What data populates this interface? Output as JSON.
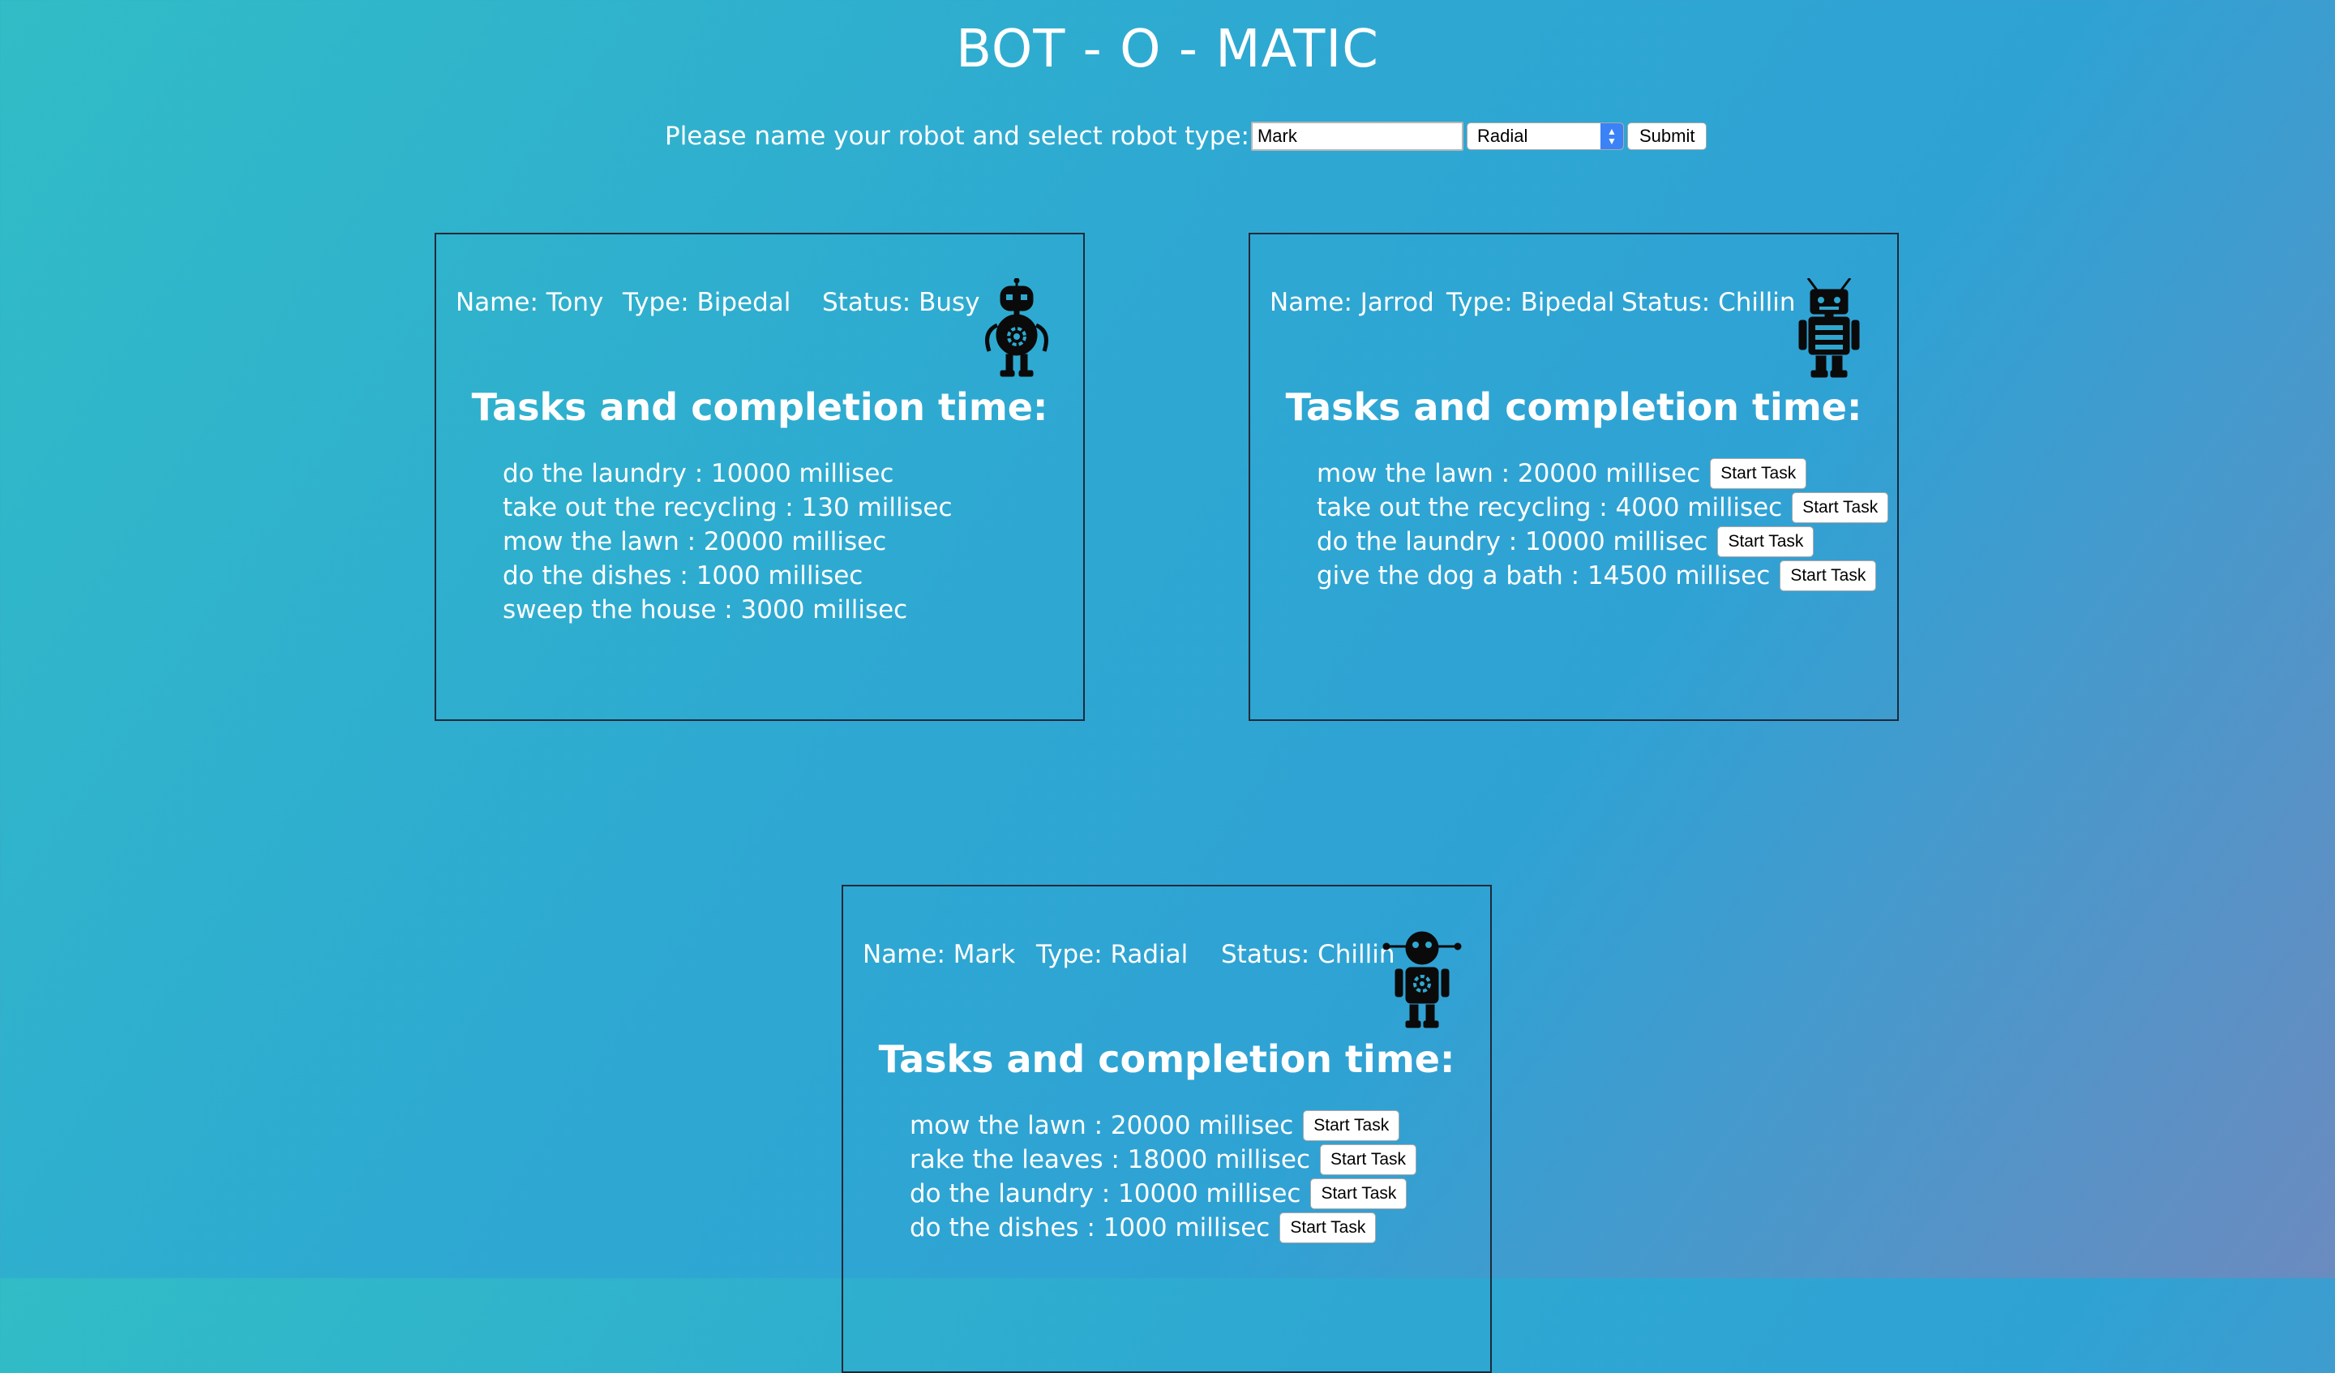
{
  "app": {
    "title": "BOT - O - MATIC"
  },
  "form": {
    "prompt": "Please name your robot and select robot type:",
    "name_value": "Mark",
    "type_selected": "Radial",
    "submit_label": "Submit"
  },
  "labels": {
    "tasks_title": "Tasks and completion time:",
    "start_task": "Start Task"
  },
  "robots": [
    {
      "name": "Name: Tony",
      "type": "Type: Bipedal",
      "status": "Status: Busy",
      "icon": "robot-gear-icon",
      "tasks": [
        "do the laundry : 10000 millisec",
        "take out the recycling : 130 millisec",
        "mow the lawn : 20000 millisec",
        "do the dishes : 1000 millisec",
        "sweep the house : 3000 millisec"
      ]
    },
    {
      "name": "Name: Jarrod",
      "type": "Type: Bipedal",
      "status": "Status: Chillin",
      "icon": "robot-antenna-icon",
      "tasks": [
        "mow the lawn : 20000 millisec",
        "take out the recycling : 4000 millisec",
        "do the laundry : 10000 millisec",
        "give the dog a bath : 14500 millisec"
      ]
    },
    {
      "name": "Name: Mark",
      "type": "Type: Radial",
      "status": "Status: Chillin",
      "icon": "robot-radial-icon",
      "tasks": [
        "mow the lawn : 20000 millisec",
        "rake the leaves : 18000 millisec",
        "do the laundry : 10000 millisec",
        "do the dishes : 1000 millisec"
      ]
    }
  ]
}
